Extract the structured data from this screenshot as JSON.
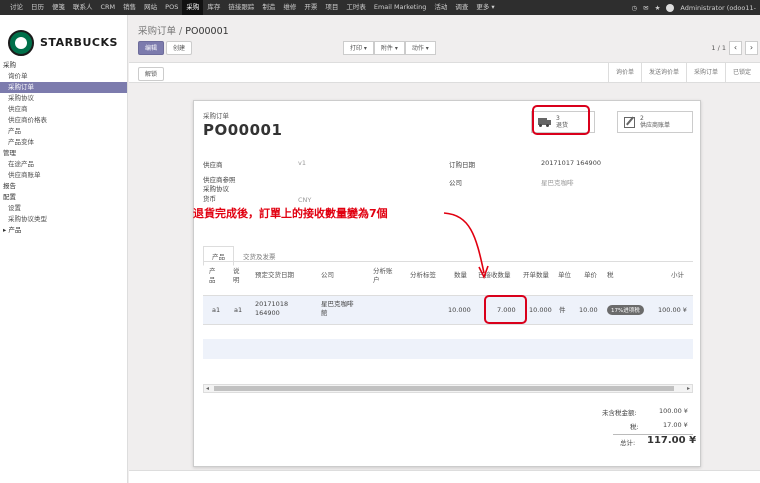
{
  "topbar": {
    "menu": [
      "讨论",
      "日历",
      "便笺",
      "联系人",
      "CRM",
      "销售",
      "网站",
      "POS",
      "采购",
      "库存",
      "链接跟踪",
      "制造",
      "维修",
      "开票",
      "项目",
      "工时表",
      "Email Marketing",
      "活动",
      "调查",
      "更多 ▾"
    ],
    "active_index": 8,
    "user": "Administrator (odoo11-"
  },
  "sidebar": {
    "logo_text": "STARBUCKS",
    "items": [
      {
        "label": "采购",
        "type": "head"
      },
      {
        "label": "询价单",
        "type": "item"
      },
      {
        "label": "采购订单",
        "type": "active"
      },
      {
        "label": "采购协议",
        "type": "item"
      },
      {
        "label": "供应商",
        "type": "item"
      },
      {
        "label": "供应商价格表",
        "type": "item"
      },
      {
        "label": "产品",
        "type": "item"
      },
      {
        "label": "产品变体",
        "type": "item"
      },
      {
        "label": "管理",
        "type": "head"
      },
      {
        "label": "在途产品",
        "type": "item"
      },
      {
        "label": "供应商账单",
        "type": "item"
      },
      {
        "label": "报告",
        "type": "head"
      },
      {
        "label": "配置",
        "type": "head"
      },
      {
        "label": "设置",
        "type": "item"
      },
      {
        "label": "采购协议类型",
        "type": "item"
      },
      {
        "label": "▸ 产品",
        "type": "head"
      }
    ]
  },
  "breadcrumb": {
    "parent": "采购订单",
    "sep": " / ",
    "current": "PO00001"
  },
  "buttons": {
    "edit": "编辑",
    "create": "创建",
    "print": "打印 ▾",
    "attachment": "附件 ▾",
    "action": "动作 ▾",
    "unlock": "解锁"
  },
  "pager": {
    "count": "1 / 1",
    "prev": "‹",
    "next": "›"
  },
  "stages": [
    "询价单",
    "发送询价单",
    "采购订单",
    "已锁定"
  ],
  "doc": {
    "label": "采购订单",
    "name": "PO00001",
    "smart_receipts_num": "3",
    "smart_receipts_label": "退货",
    "smart_bills_num": "2",
    "smart_bills_label": "供应商账单",
    "vendor_label": "供应商",
    "vendor_value": "v1",
    "vendor_ref_label": "供应商参照",
    "agreement_label": "采购协议",
    "currency_label": "货币",
    "currency_value": "CNY",
    "order_date_label": "订购日期",
    "order_date_value": "20171017 164900",
    "company_label": "公司",
    "company_value": "星巴克咖啡"
  },
  "annotation": "退貨完成後，訂單上的接收數量變為7個",
  "tabs": [
    "产品",
    "交货及发票"
  ],
  "table": {
    "headers": {
      "product": "产\n品",
      "desc": "说\n明",
      "planned_date": "预定交货日期",
      "company": "公司",
      "analytic_account": "分析账\n户",
      "analytic_tags": "分析标签",
      "qty": "数量",
      "received": "已接收数量",
      "billed": "开单数量",
      "uom": "单位",
      "price": "单价",
      "tax": "税",
      "subtotal": "小计"
    },
    "row": {
      "product": "a1",
      "desc": "a1",
      "planned_date_1": "20171018",
      "planned_date_2": "164900",
      "company_1": "星巴克咖啡",
      "company_2": "館",
      "qty": "10.000",
      "received": "7.000",
      "billed": "10.000",
      "uom": "件",
      "price": "10.00",
      "tax": "17%进项税",
      "subtotal": "100.00 ¥"
    }
  },
  "totals": {
    "untaxed_label": "未含税金额:",
    "untaxed_value": "100.00 ¥",
    "tax_label": "税:",
    "tax_value": "17.00 ¥",
    "total_label": "总计:",
    "total_value": "117.00 ¥"
  }
}
